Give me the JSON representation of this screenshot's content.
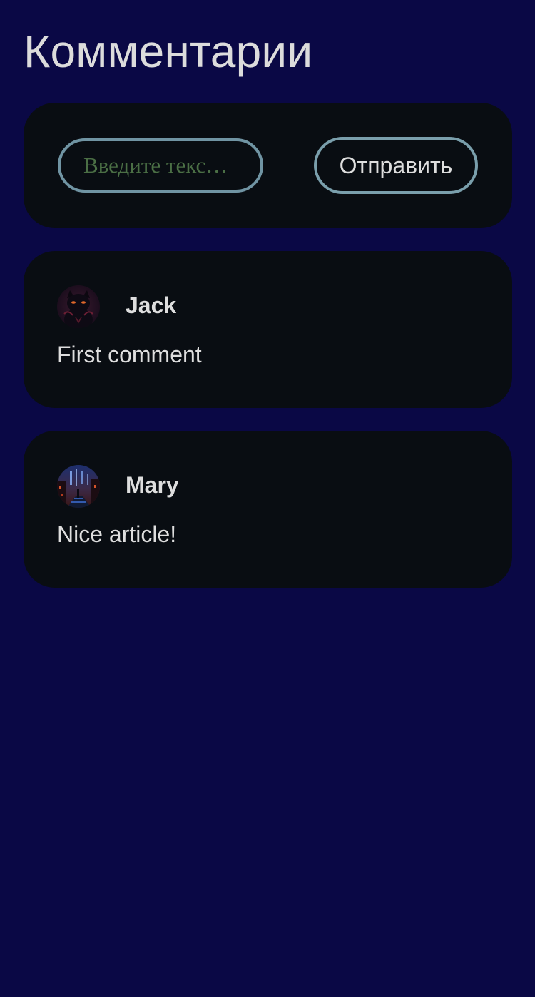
{
  "page": {
    "title": "Комментарии"
  },
  "composer": {
    "input_placeholder": "Введите текс…",
    "input_value": "",
    "send_label": "Отправить"
  },
  "comments": [
    {
      "author": "Jack",
      "text": "First comment",
      "avatar_icon": "black-cat-avatar-icon"
    },
    {
      "author": "Mary",
      "text": "Nice article!",
      "avatar_icon": "night-city-avatar-icon"
    }
  ],
  "colors": {
    "background": "#0a0845",
    "card": "#090d12",
    "border_accent": "#7094a3",
    "placeholder_text": "#4b6f45",
    "text": "#dedede"
  }
}
